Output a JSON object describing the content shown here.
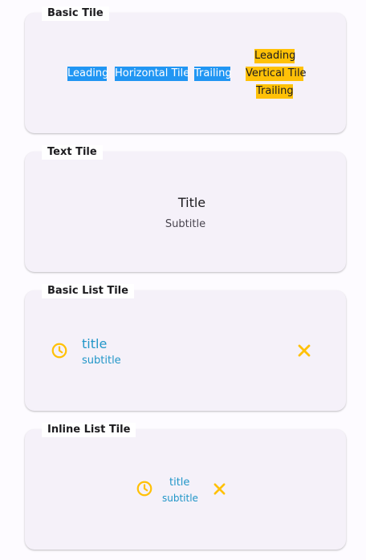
{
  "basic_tile": {
    "label": "Basic Tile",
    "horizontal": {
      "leading": "Leading",
      "title": "Horizontal Tile",
      "trailing": "Trailing"
    },
    "vertical": {
      "leading": "Leading",
      "title": "Vertical Tile",
      "trailing": "Trailing"
    }
  },
  "text_tile": {
    "label": "Text Tile",
    "title": "Title",
    "subtitle": "Subtitle"
  },
  "basic_list_tile": {
    "label": "Basic List Tile",
    "leading_icon": "clock-icon",
    "title": "title",
    "subtitle": "subtitle",
    "trailing_icon": "close-icon"
  },
  "inline_list_tile": {
    "label": "Inline List Tile",
    "leading_icon": "clock-icon",
    "title": "title",
    "subtitle": "subtitle",
    "trailing_icon": "close-icon"
  },
  "colors": {
    "blue": "#2196f3",
    "amber": "#ffc107",
    "link": "#2196c8",
    "card": "#f5f1f9"
  }
}
